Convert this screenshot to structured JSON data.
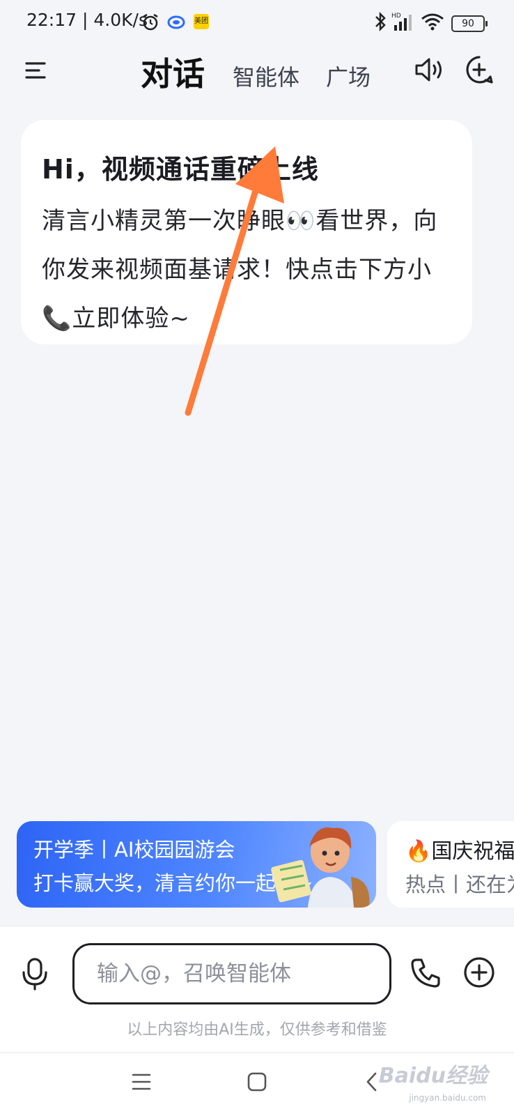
{
  "status_bar": {
    "time": "22:17",
    "network_speed": "4.0K/s",
    "meituan_badge": "美团",
    "battery": "90"
  },
  "header": {
    "tabs": [
      {
        "label": "对话",
        "active": true
      },
      {
        "label": "智能体",
        "active": false
      },
      {
        "label": "广场",
        "active": false
      }
    ]
  },
  "message_card": {
    "title": "Hi，视频通话重磅上线",
    "body": "清言小精灵第一次睁眼👀看世界，向你发来视频面基请求！快点击下方小📞立即体验~"
  },
  "banners": [
    {
      "line1": "开学季丨AI校园园游会",
      "line2": "打卡赢大奖，清言约你一起逛~"
    },
    {
      "line1": "🔥国庆祝福",
      "line2": "热点丨还在为"
    }
  ],
  "input": {
    "placeholder": "输入@，召唤智能体",
    "value": ""
  },
  "disclaimer": "以上内容均由AI生成，仅供参考和借鉴",
  "watermark": {
    "brand": "Baidu经验",
    "domain": "jingyan.baidu.com"
  },
  "colors": {
    "accent": "#2d64f5",
    "annotation_arrow": "#ff7b3a",
    "background": "#f4f5f8"
  },
  "icons": [
    "menu-icon",
    "speaker-icon",
    "new-chat-icon",
    "microphone-icon",
    "phone-icon",
    "add-icon",
    "nav-menu-icon",
    "nav-home-icon",
    "nav-back-icon",
    "bluetooth-icon",
    "signal-icon",
    "wifi-icon",
    "alarm-icon"
  ]
}
